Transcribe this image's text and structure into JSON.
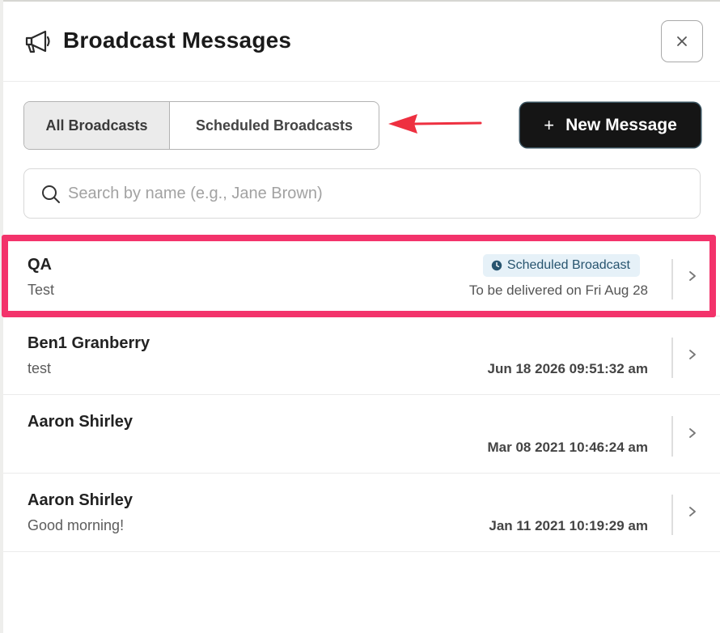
{
  "header": {
    "title": "Broadcast Messages",
    "icon": "megaphone-icon",
    "close_glyph": "×"
  },
  "tabs": [
    {
      "label": "All Broadcasts",
      "selected": true
    },
    {
      "label": "Scheduled Broadcasts",
      "selected": false
    }
  ],
  "new_message": {
    "plus": "+",
    "label": "New Message"
  },
  "search": {
    "placeholder": "Search by name (e.g., Jane Brown)",
    "value": ""
  },
  "messages": [
    {
      "name": "QA",
      "preview": "Test",
      "badge": "Scheduled Broadcast",
      "date": "To be delivered on Fri Aug 28"
    },
    {
      "name": "Ben1 Granberry",
      "preview": "test",
      "date": "Jun 18 2026 09:51:32 am"
    },
    {
      "name": "Aaron Shirley",
      "preview": "",
      "date": "Mar 08 2021 10:46:24 am"
    },
    {
      "name": "Aaron Shirley",
      "preview": "Good morning!",
      "date": "Jan 11 2021 10:19:29 am"
    }
  ],
  "colors": {
    "accent_dark": "#151515",
    "highlight": "#f3336b",
    "annotation_arrow": "#ee3040",
    "badge_bg": "#e6f1f8",
    "badge_text": "#27546f"
  }
}
